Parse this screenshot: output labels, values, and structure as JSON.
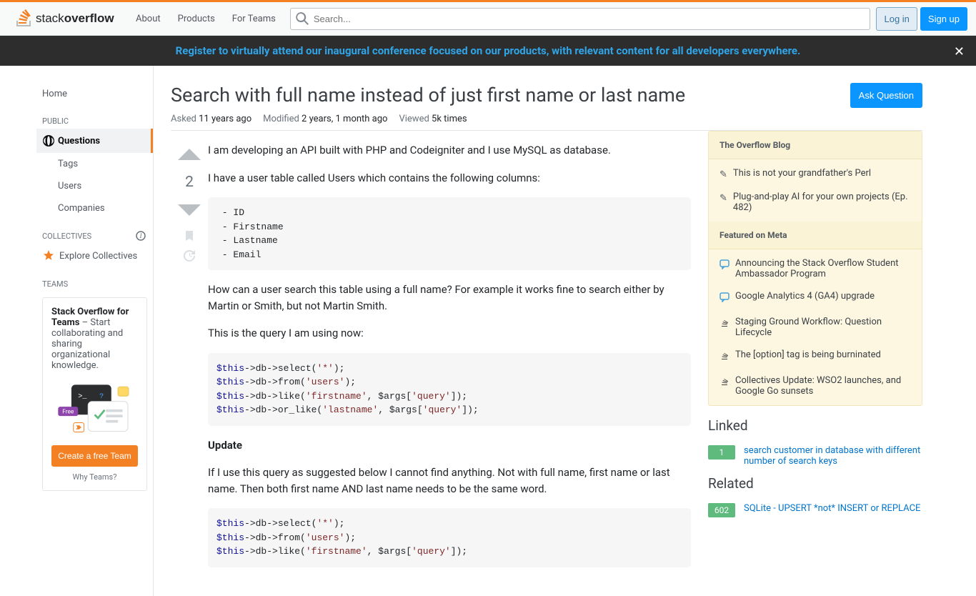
{
  "topbar": {
    "nav": [
      "About",
      "Products",
      "For Teams"
    ],
    "search_placeholder": "Search...",
    "login": "Log in",
    "signup": "Sign up"
  },
  "banner": {
    "text": "Register to virtually attend our inaugural conference focused on our products, with relevant content for all developers everywhere."
  },
  "sidebar": {
    "home": "Home",
    "public_heading": "PUBLIC",
    "items": [
      "Questions",
      "Tags",
      "Users",
      "Companies"
    ],
    "collectives_heading": "COLLECTIVES",
    "explore_collectives": "Explore Collectives",
    "teams_heading": "TEAMS",
    "teams_strong": "Stack Overflow for Teams",
    "teams_desc": " – Start collaborating and sharing organizational knowledge.",
    "free_badge": "Free",
    "create_team": "Create a free Team",
    "why_teams": "Why Teams?"
  },
  "question": {
    "title": "Search with full name instead of just first name or last name",
    "ask_button": "Ask Question",
    "asked_label": "Asked",
    "asked_value": "11 years ago",
    "modified_label": "Modified",
    "modified_value": "2 years, 1 month ago",
    "viewed_label": "Viewed",
    "viewed_value": "5k times",
    "vote_count": "2",
    "body": {
      "p1": "I am developing an API built with PHP and Codeigniter and I use MySQL as database.",
      "p2": "I have a user table called Users which contains the following columns:",
      "code1": " - ID\n - Firstname\n - Lastname\n - Email",
      "p3": "How can a user search this table using a full name? For example it works fine to search either by Martin or Smith, but not Martin Smith.",
      "p4": "This is the query I am using now:",
      "code2_html": "<span class='kw'>$this</span>-&gt;db-&gt;select(<span class='str'>'*'</span>);\n<span class='kw'>$this</span>-&gt;db-&gt;from(<span class='str'>'users'</span>);\n<span class='kw'>$this</span>-&gt;db-&gt;like(<span class='str'>'firstname'</span>, $args[<span class='str'>'query'</span>]);\n<span class='kw'>$this</span>-&gt;db-&gt;or_like(<span class='str'>'lastname'</span>, $args[<span class='str'>'query'</span>]);",
      "update_heading": "Update",
      "p5": "If I use this query as suggested below I cannot find anything. Not with full name, first name or last name. Then both first name AND last name needs to be the same word.",
      "code3_html": "<span class='kw'>$this</span>-&gt;db-&gt;select(<span class='str'>'*'</span>);\n<span class='kw'>$this</span>-&gt;db-&gt;from(<span class='str'>'users'</span>);\n<span class='kw'>$this</span>-&gt;db-&gt;like(<span class='str'>'firstname'</span>, $args[<span class='str'>'query'</span>]);"
    }
  },
  "right": {
    "blog_heading": "The Overflow Blog",
    "blog_items": [
      "This is not your grandfather's Perl",
      "Plug-and-play AI for your own projects (Ep. 482)"
    ],
    "meta_heading": "Featured on Meta",
    "meta_items": [
      "Announcing the Stack Overflow Student Ambassador Program",
      "Google Analytics 4 (GA4) upgrade",
      "Staging Ground Workflow: Question Lifecycle",
      "The [option] tag is being burninated",
      "Collectives Update: WSO2 launches, and Google Go sunsets"
    ],
    "linked_heading": "Linked",
    "linked": [
      {
        "score": "1",
        "title": "search customer in database with different number of search keys"
      }
    ],
    "related_heading": "Related",
    "related": [
      {
        "score": "602",
        "title": "SQLite - UPSERT *not* INSERT or REPLACE"
      }
    ]
  }
}
